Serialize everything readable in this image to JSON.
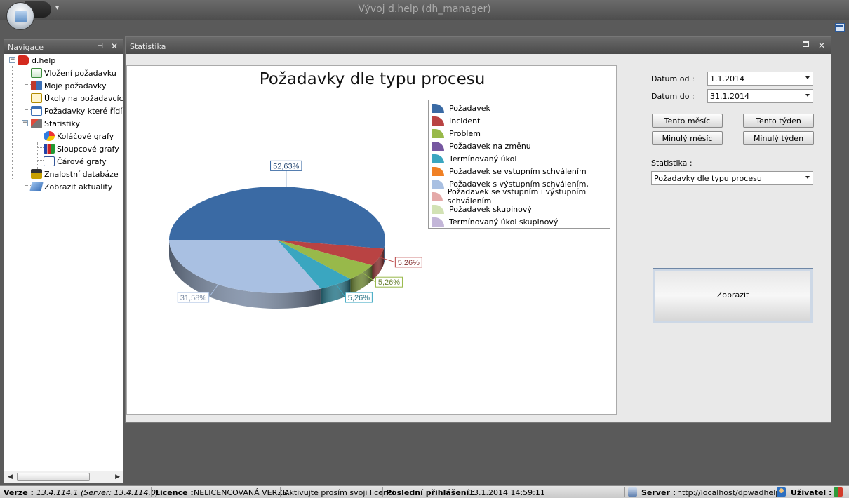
{
  "window": {
    "title": "Vývoj d.help (dh_manager)"
  },
  "navigation": {
    "title": "Navigace",
    "items": [
      {
        "label": "d.help",
        "icon": "dhelp-logo-icon"
      },
      {
        "label": "Vložení požadavku",
        "icon": "add-request-icon"
      },
      {
        "label": "Moje požadavky",
        "icon": "my-requests-icon"
      },
      {
        "label": "Úkoly na požadavcích",
        "icon": "tasks-icon"
      },
      {
        "label": "Požadavky které řídím (",
        "icon": "calendar-icon"
      },
      {
        "label": "Statistiky",
        "icon": "statistics-icon"
      },
      {
        "label": "Koláčové grafy",
        "icon": "pie-chart-icon"
      },
      {
        "label": "Sloupcové grafy",
        "icon": "bar-chart-icon"
      },
      {
        "label": "Čárové grafy",
        "icon": "line-chart-icon"
      },
      {
        "label": "Znalostní databáze",
        "icon": "knowledge-base-icon"
      },
      {
        "label": "Zobrazit aktuality",
        "icon": "news-icon"
      }
    ]
  },
  "document": {
    "title": "Statistika"
  },
  "chart_data": {
    "type": "pie",
    "title": "Požadavky dle typu procesu",
    "categories": [
      "Požadavek",
      "Incident",
      "Problem",
      "Požadavek na změnu",
      "Termínovaný úkol",
      "Požadavek se vstupním schválením",
      "Požadavek s výstupním schválením,",
      "Požadavek se vstupním i výstupním schválením",
      "Požadavek skupinový",
      "Termínovaný úkol skupinový"
    ],
    "values": [
      52.63,
      5.26,
      5.26,
      0,
      5.26,
      0,
      31.58,
      0,
      0,
      0
    ],
    "data_labels": [
      "52,63%",
      "5,26%",
      "5,26%",
      "5,26%",
      "31,58%"
    ],
    "colors": [
      "#3a6aa4",
      "#b94343",
      "#98b94a",
      "#7657a0",
      "#3aa6c0",
      "#f08024",
      "#a9c0e2",
      "#e4a9a8",
      "#d2e2b4",
      "#c3b6d8"
    ],
    "legend_position": "top-right"
  },
  "controls": {
    "date_from_label": "Datum od :",
    "date_from_value": "1.1.2014",
    "date_to_label": "Datum do :",
    "date_to_value": "31.1.2014",
    "this_month": "Tento měsíc",
    "this_week": "Tento týden",
    "last_month": "Minulý měsíc",
    "last_week": "Minulý týden",
    "statistic_label": "Statistika :",
    "statistic_value": "Požadavky dle typu procesu",
    "show_button": "Zobrazit"
  },
  "status": {
    "version_label": "Verze :",
    "version_value": "13.4.114.1 (Server: 13.4.114.0)",
    "licence_label": "Licence :",
    "licence_value": "NELICENCOVANÁ VERZE",
    "activate_text": "Aktivujte prosím svoji licenci",
    "last_login_label": "Poslední přihlášení :",
    "last_login_value": "13.1.2014 14:59:11",
    "server_label": "Server :",
    "server_value": "http://localhost/dpwadhelp",
    "user_label": "Uživatel :"
  }
}
